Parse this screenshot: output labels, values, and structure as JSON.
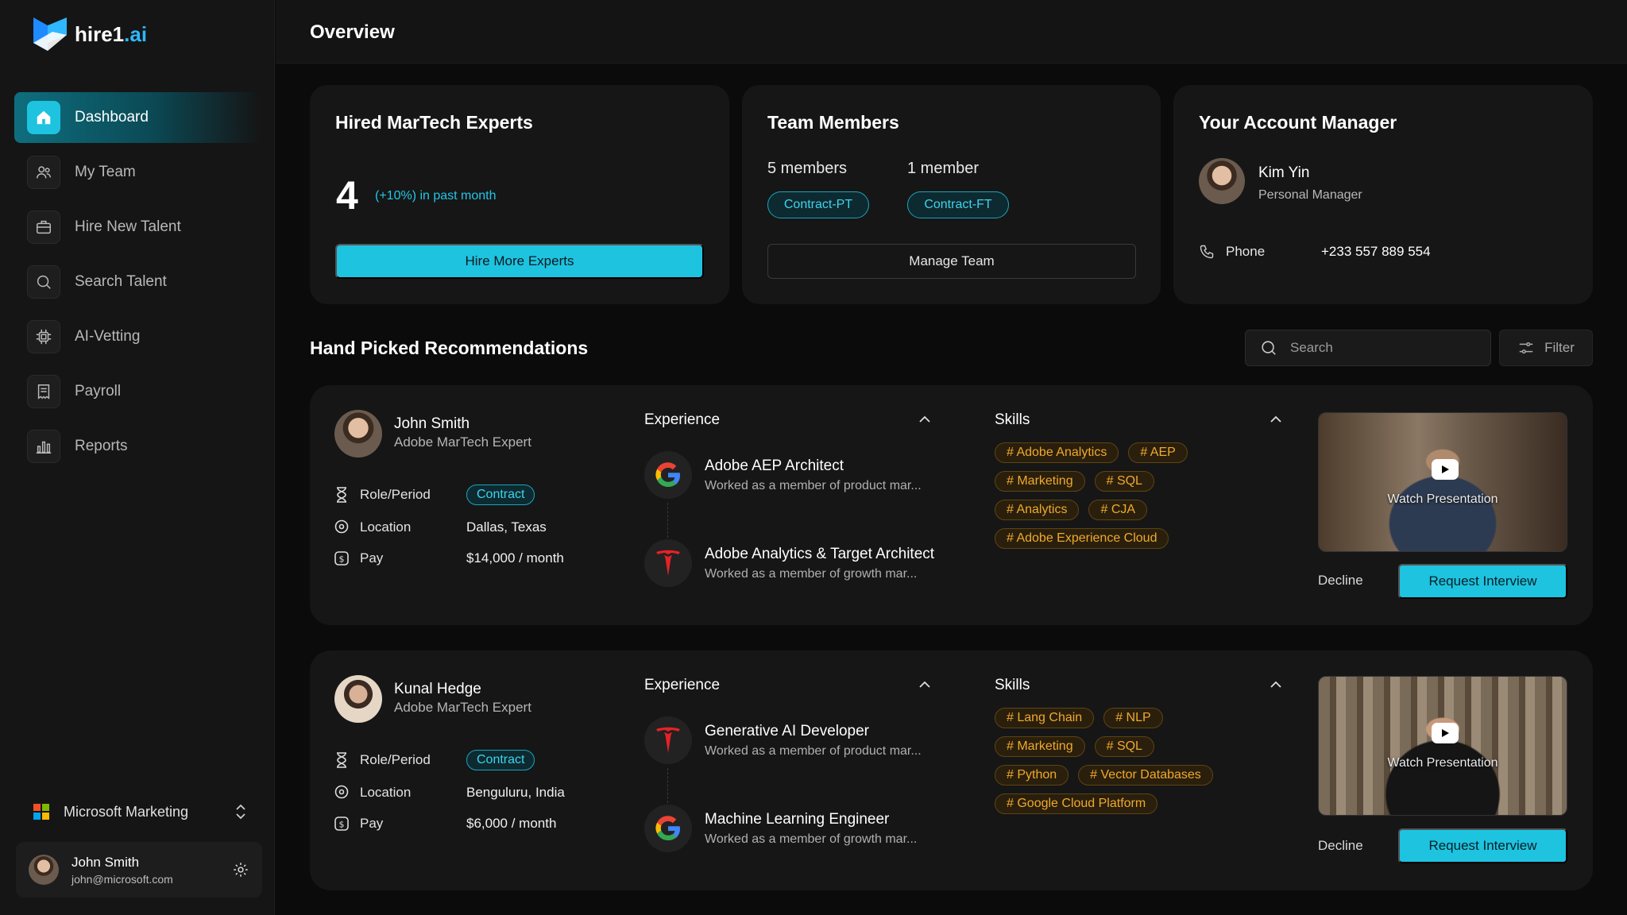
{
  "brand": {
    "name": "hire1",
    "suffix": ".ai"
  },
  "sidebar": {
    "items": [
      {
        "label": "Dashboard",
        "icon": "home-icon",
        "active": true
      },
      {
        "label": "My Team",
        "icon": "team-icon"
      },
      {
        "label": "Hire New Talent",
        "icon": "briefcase-icon"
      },
      {
        "label": "Search Talent",
        "icon": "search-icon"
      },
      {
        "label": "AI-Vetting",
        "icon": "chip-icon"
      },
      {
        "label": "Payroll",
        "icon": "receipt-icon"
      },
      {
        "label": "Reports",
        "icon": "bar-chart-icon"
      }
    ],
    "org": {
      "label": "Microsoft Marketing"
    },
    "user": {
      "name": "John Smith",
      "email": "john@microsoft.com"
    }
  },
  "header": {
    "title": "Overview"
  },
  "cards": {
    "hired": {
      "title": "Hired MarTech Experts",
      "count": "4",
      "growth": "(+10%) in past month",
      "button": "Hire More Experts"
    },
    "team": {
      "title": "Team Members",
      "groups": [
        {
          "count": "5 members",
          "type": "Contract-PT"
        },
        {
          "count": "1 member",
          "type": "Contract-FT"
        }
      ],
      "button": "Manage Team"
    },
    "manager": {
      "title": "Your Account Manager",
      "name": "Kim Yin",
      "role": "Personal Manager",
      "phone_label": "Phone",
      "phone": "+233 557 889 554"
    }
  },
  "recommendations": {
    "title": "Hand Picked Recommendations",
    "search_placeholder": "Search",
    "filter_label": "Filter",
    "labels": {
      "experience": "Experience",
      "skills": "Skills",
      "role": "Role/Period",
      "location": "Location",
      "pay": "Pay",
      "watch": "Watch Presentation",
      "decline": "Decline",
      "request": "Request Interview"
    },
    "candidates": [
      {
        "name": "John Smith",
        "title": "Adobe MarTech Expert",
        "role": "Contract",
        "location": "Dallas, Texas",
        "pay": "$14,000 / month",
        "experience": [
          {
            "company_icon": "google-icon",
            "title": "Adobe AEP Architect",
            "desc": "Worked as a member of product mar..."
          },
          {
            "company_icon": "tesla-icon",
            "title": "Adobe Analytics & Target Architect",
            "desc": "Worked as a member of growth mar..."
          }
        ],
        "skills": [
          [
            "# Adobe Analytics",
            "# AEP"
          ],
          [
            "# Marketing",
            "# SQL"
          ],
          [
            "# Analytics",
            "# CJA"
          ],
          [
            "# Adobe Experience Cloud"
          ]
        ]
      },
      {
        "name": "Kunal Hedge",
        "title": "Adobe MarTech Expert",
        "role": "Contract",
        "location": "Benguluru, India",
        "pay": "$6,000 / month",
        "experience": [
          {
            "company_icon": "tesla-icon",
            "title": "Generative AI Developer",
            "desc": "Worked as a member of product mar..."
          },
          {
            "company_icon": "google-icon",
            "title": "Machine Learning Engineer",
            "desc": "Worked as a member of growth mar..."
          }
        ],
        "skills": [
          [
            "# Lang Chain",
            "# NLP"
          ],
          [
            "# Marketing",
            "# SQL"
          ],
          [
            "# Python",
            "# Vector Databases"
          ],
          [
            "# Google Cloud Platform"
          ]
        ]
      }
    ]
  },
  "colors": {
    "accent": "#1ec3e0",
    "skill": "#f0a92c",
    "background": "#0b0b0b",
    "card": "#161616"
  }
}
